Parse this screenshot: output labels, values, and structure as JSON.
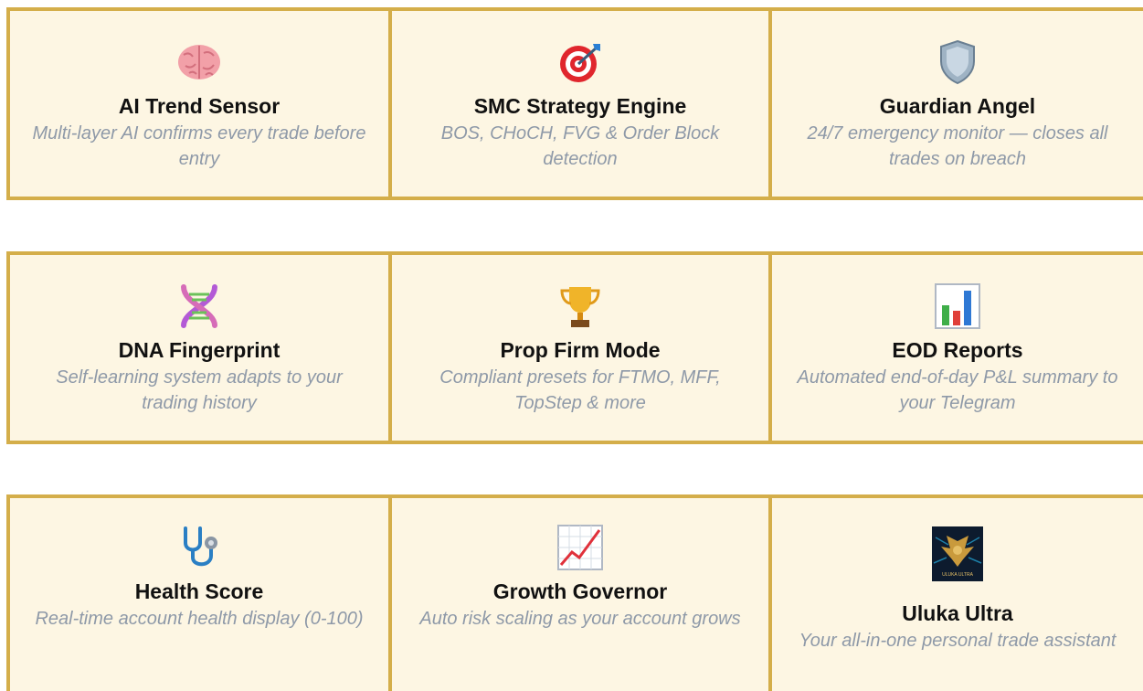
{
  "features": [
    {
      "title": "AI Trend Sensor",
      "desc": "Multi-layer AI confirms every trade before entry",
      "icon": "brain-icon"
    },
    {
      "title": "SMC Strategy Engine",
      "desc": "BOS, CHoCH, FVG & Order Block detection",
      "icon": "target-icon"
    },
    {
      "title": "Guardian Angel",
      "desc": "24/7 emergency monitor — closes all trades on breach",
      "icon": "shield-icon"
    },
    {
      "title": "DNA Fingerprint",
      "desc": "Self-learning system adapts to your trading history",
      "icon": "dna-icon"
    },
    {
      "title": "Prop Firm Mode",
      "desc": "Compliant presets for FTMO, MFF, TopStep & more",
      "icon": "trophy-icon"
    },
    {
      "title": "EOD Reports",
      "desc": "Automated end-of-day P&L summary to your Telegram",
      "icon": "bar-chart-icon"
    },
    {
      "title": "Health Score",
      "desc": "Real-time account health display (0-100)",
      "icon": "stethoscope-icon"
    },
    {
      "title": "Growth Governor",
      "desc": "Auto risk scaling as your account grows",
      "icon": "trending-up-chart-icon"
    },
    {
      "title": "Uluka Ultra",
      "desc": "Your all-in-one personal trade assistant",
      "icon": "uluka-logo-icon",
      "logo_text": "ULUKA ULTRA"
    }
  ],
  "colors": {
    "card_bg": "#fdf6e3",
    "border": "#d4ae4a",
    "title": "#111111",
    "desc": "#8e99a8"
  }
}
